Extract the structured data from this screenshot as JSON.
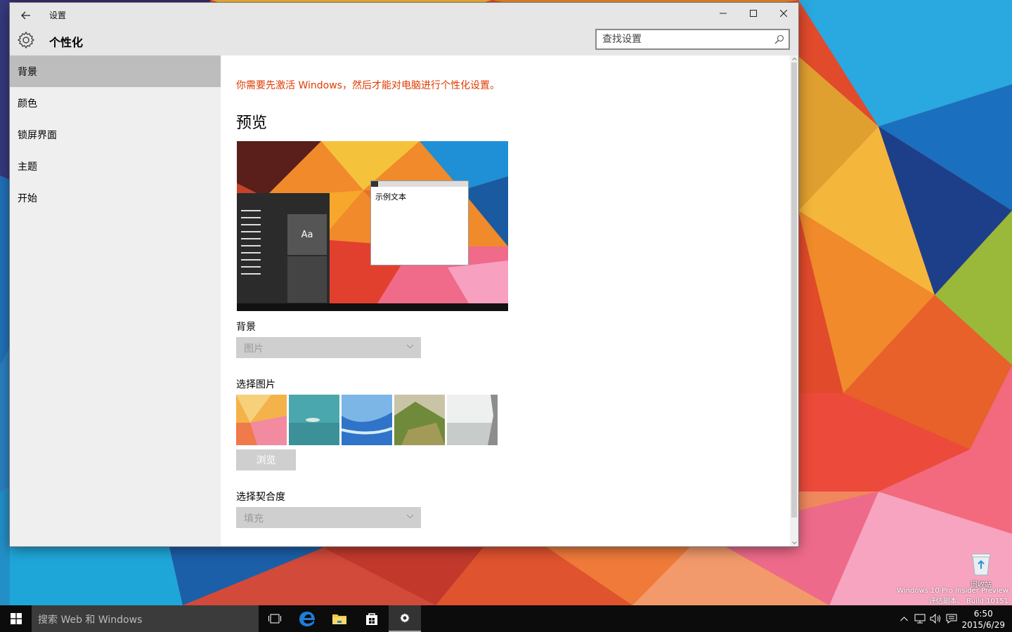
{
  "window": {
    "title": "设置",
    "page_title": "个性化",
    "search_placeholder": "查找设置"
  },
  "sidebar": {
    "items": [
      {
        "label": "背景",
        "selected": true
      },
      {
        "label": "颜色",
        "selected": false
      },
      {
        "label": "锁屏界面",
        "selected": false
      },
      {
        "label": "主题",
        "selected": false
      },
      {
        "label": "开始",
        "selected": false
      }
    ]
  },
  "content": {
    "activation_warning": "你需要先激活 Windows，然后才能对电脑进行个性化设置。",
    "preview_heading": "预览",
    "preview_tile_text": "Aa",
    "preview_sample_text": "示例文本",
    "background_label": "背景",
    "background_value": "图片",
    "choose_picture_label": "选择图片",
    "browse_label": "浏览",
    "fit_label": "选择契合度",
    "fit_value": "填充"
  },
  "desktop": {
    "recycle_bin_label": "回收站",
    "watermark_line1": "Windows 10 Pro Insider Preview",
    "watermark_line2": "评估副本。 Build 10151"
  },
  "taskbar": {
    "search_text": "搜索 Web 和 Windows",
    "time": "6:50",
    "date": "2015/6/29"
  },
  "colors": {
    "warning": "#e03a00",
    "sidebar_selected": "#bdbdbd",
    "taskbar": "#0c0c0c",
    "edge_blue": "#1e7fd6"
  },
  "icons": [
    "back-arrow-icon",
    "minimize-icon",
    "maximize-icon",
    "close-icon",
    "gear-icon",
    "search-icon",
    "chevron-down-icon",
    "windows-logo-icon",
    "task-view-icon",
    "edge-icon",
    "file-explorer-icon",
    "store-icon",
    "settings-icon",
    "chevron-up-icon",
    "network-icon",
    "volume-icon",
    "action-center-icon",
    "recycle-bin-icon"
  ]
}
